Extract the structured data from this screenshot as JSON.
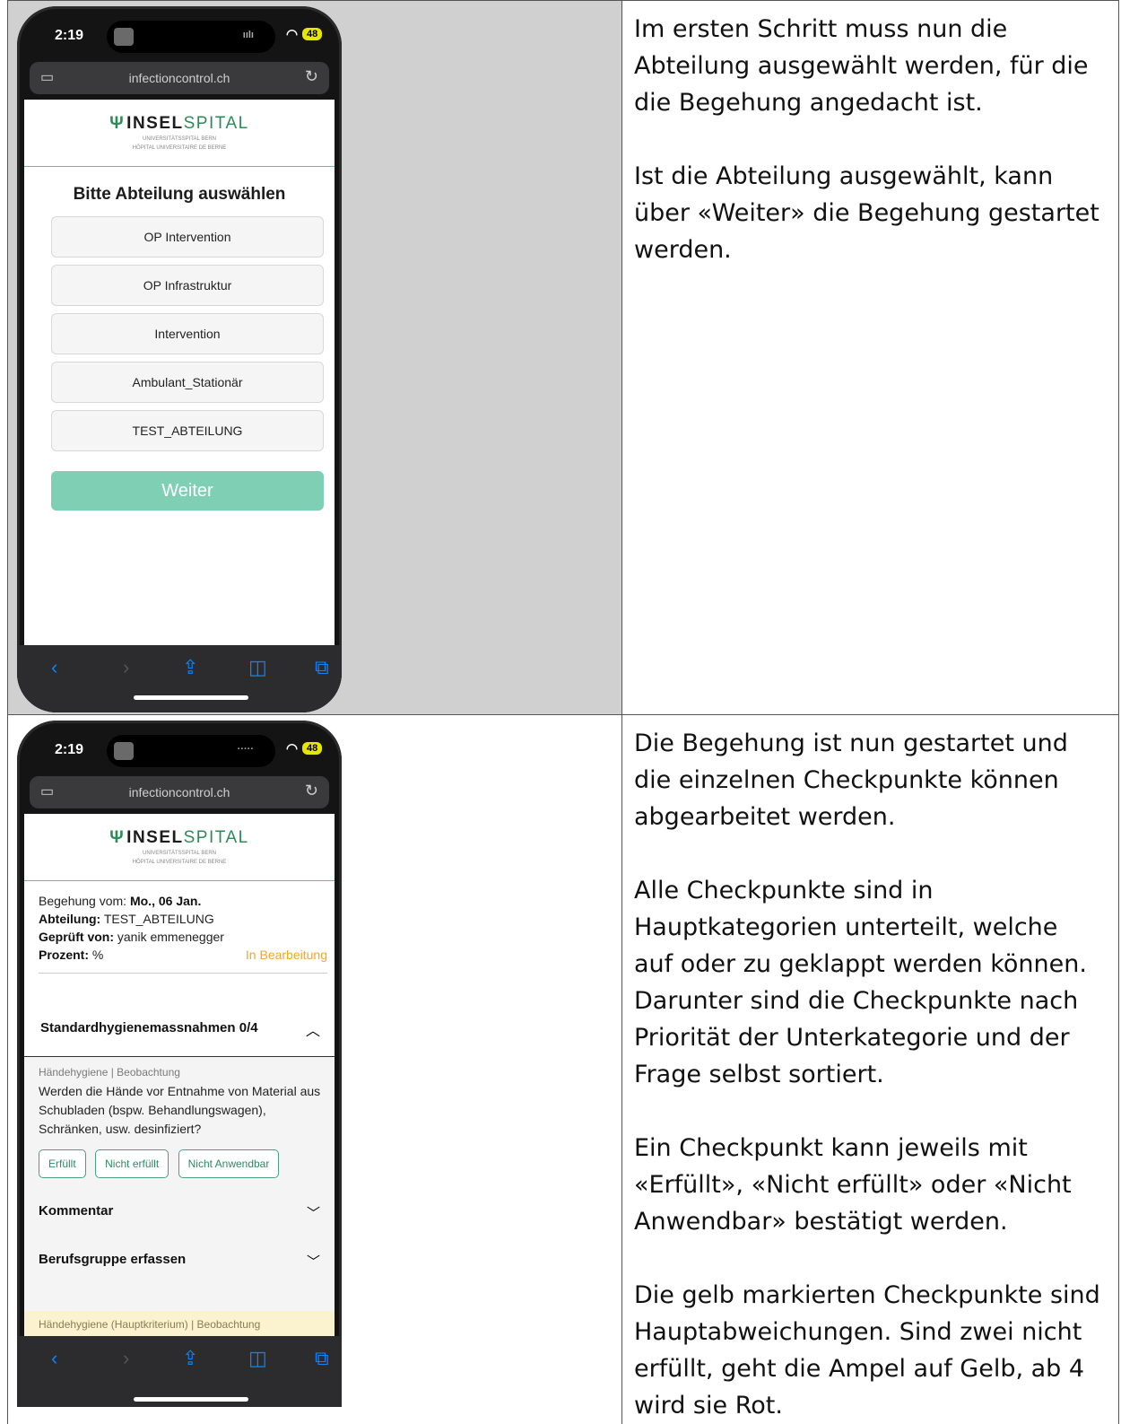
{
  "rows": [
    {
      "phone": {
        "time": "2:19",
        "battery": "48",
        "url": "infectioncontrol.ch",
        "logo": {
          "name_a": "INSEL",
          "name_b": "SPITAL",
          "sub1": "UNIVERSITÄTSSPITAL BERN",
          "sub2": "HÔPITAL UNIVERSITAIRE DE BERNE"
        },
        "heading": "Bitte Abteilung auswählen",
        "options": [
          "OP Intervention",
          "OP Infrastruktur",
          "Intervention",
          "Ambulant_Stationär",
          "TEST_ABTEILUNG"
        ],
        "weiter": "Weiter"
      },
      "paragraphs": [
        "Im ersten Schritt muss nun die Abteilung ausgewählt werden, für die die Begehung angedacht ist.",
        "Ist die Abteilung ausgewählt, kann über «Weiter» die Begehung gestartet werden."
      ]
    },
    {
      "phone": {
        "time": "2:19",
        "battery": "48",
        "url": "infectioncontrol.ch",
        "logo": {
          "name_a": "INSEL",
          "name_b": "SPITAL",
          "sub1": "UNIVERSITÄTSSPITAL BERN",
          "sub2": "HÔPITAL UNIVERSITAIRE DE BERNE"
        },
        "info": {
          "begehung_label": "Begehung vom:",
          "begehung_value": "Mo., 06 Jan.",
          "abteilung_label": "Abteilung:",
          "abteilung_value": "TEST_ABTEILUNG",
          "geprueft_label": "Geprüft von:",
          "geprueft_value": "yanik emmenegger",
          "prozent_label": "Prozent:",
          "prozent_value": "%",
          "status": "In Bearbeitung"
        },
        "section_title": "Standardhygienemassnahmen 0/4",
        "question_meta": "Händehygiene | Beobachtung",
        "question_text": "Werden die Hände vor Entnahme von Material aus Schubladen (bspw. Behandlungswagen), Schränken, usw. desinfiziert?",
        "buttons": [
          "Erfüllt",
          "Nicht erfüllt",
          "Nicht Anwendbar"
        ],
        "kommentar": "Kommentar",
        "berufsgruppe": "Berufsgruppe erfassen",
        "next_meta": "Händehygiene (Hauptkriterium) | Beobachtung"
      },
      "paragraphs": [
        "Die Begehung ist nun gestartet und die einzelnen Checkpunkte können abgearbeitet werden.",
        "Alle Checkpunkte sind in Hauptkategorien unterteilt, welche auf oder zu geklappt werden können. Darunter sind die Checkpunkte nach Priorität der Unterkategorie und der Frage selbst sortiert.",
        "Ein Checkpunkt kann jeweils mit «Erfüllt», «Nicht erfüllt» oder «Nicht Anwendbar» bestätigt werden.",
        "Die gelb markierten Checkpunkte sind Hauptabweichungen. Sind zwei nicht erfüllt, geht die Ampel auf Gelb, ab 4 wird sie Rot."
      ]
    }
  ]
}
